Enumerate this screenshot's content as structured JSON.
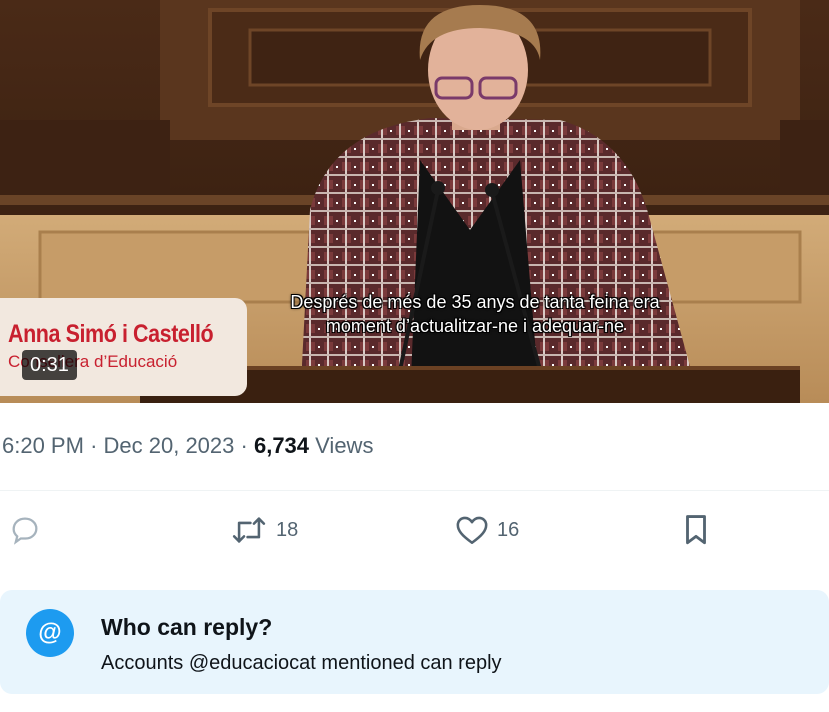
{
  "video": {
    "speaker_name": "Anna Simó i Castelló",
    "speaker_role": "Consellera d’Educació",
    "duration": "0:31",
    "subtitle_line1": "Després de més de 35 anys de tanta feina era",
    "subtitle_line2": "moment d’actualitzar-ne i adequar-ne"
  },
  "meta": {
    "time": "6:20 PM",
    "separator": "·",
    "date": "Dec 20, 2023",
    "views_count": "6,734",
    "views_label": "Views"
  },
  "actions": {
    "reply_icon": "reply-bubble-icon",
    "retweet_icon": "retweet-icon",
    "retweet_count": "18",
    "like_icon": "heart-icon",
    "like_count": "16",
    "bookmark_icon": "bookmark-icon"
  },
  "who_can_reply": {
    "icon_glyph": "@",
    "title": "Who can reply?",
    "text": "Accounts @educaciocat mentioned can reply"
  },
  "colors": {
    "secondary_text": "#536471",
    "primary_text": "#0f1419",
    "accent_blue": "#1d9bf0",
    "info_bg": "#e8f5fd",
    "nameplate_red": "#c8202f"
  }
}
